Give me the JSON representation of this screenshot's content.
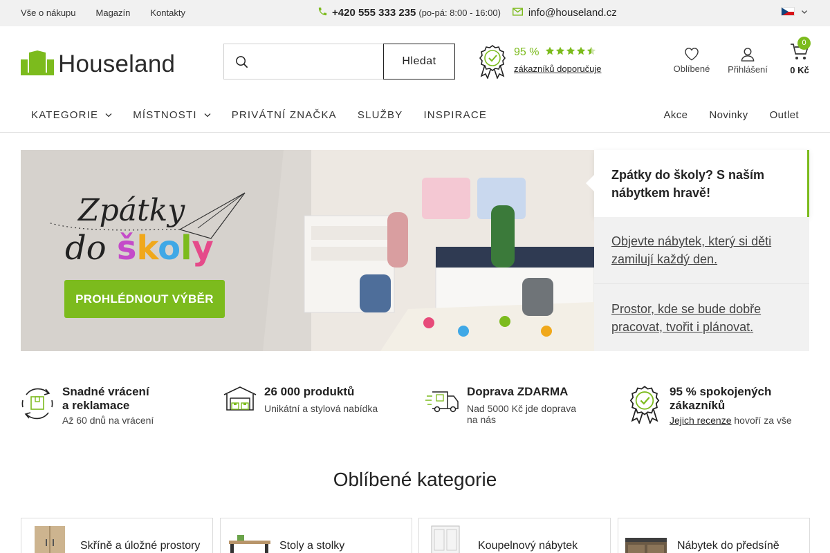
{
  "topbar": {
    "links": [
      "Vše o nákupu",
      "Magazín",
      "Kontakty"
    ],
    "phone": "+420 555 333 235",
    "hours": "(po-pá: 8:00 - 16:00)",
    "email": "info@houseland.cz",
    "language_icon": "czech-flag-icon"
  },
  "header": {
    "logo_text": "Houseland",
    "search_placeholder": "",
    "search_button": "Hledat",
    "rating_percent": "95 %",
    "rating_stars": 4.5,
    "rating_link": "zákazníků doporučuje",
    "favorites_label": "Oblíbené",
    "login_label": "Přihlášení",
    "cart_count": "0",
    "cart_total": "0 Kč"
  },
  "nav": {
    "main": [
      {
        "label": "KATEGORIE",
        "has_dropdown": true
      },
      {
        "label": "MÍSTNOSTI",
        "has_dropdown": true
      },
      {
        "label": "PRIVÁTNÍ ZNAČKA",
        "has_dropdown": false
      },
      {
        "label": "SLUŽBY",
        "has_dropdown": false
      },
      {
        "label": "INSPIRACE",
        "has_dropdown": false
      }
    ],
    "side": [
      "Akce",
      "Novinky",
      "Outlet"
    ]
  },
  "hero": {
    "headline_line1": "Zpátky",
    "headline_do": "do",
    "headline_skoly": [
      "š",
      "k",
      "o",
      "l",
      "y"
    ],
    "skoly_colors": [
      "#c44bc9",
      "#f0a81b",
      "#3fa8e6",
      "#7cbb1d",
      "#e54b8a"
    ],
    "cta": "PROHLÉDNOUT VÝBĚR",
    "slides": [
      "Zpátky do školy? S naším nábytkem hravě!",
      "Objevte nábytek, který si děti zamilují každý den.",
      "Prostor, kde se bude dobře pracovat, tvořit i plánovat."
    ]
  },
  "benefits": [
    {
      "title_line1": "Snadné vrácení",
      "title_line2": "a reklamace",
      "desc": "Až 60 dnů na vrácení",
      "icon": "return-box-icon"
    },
    {
      "title_line1": "26 000 produktů",
      "title_line2": "",
      "desc": "Unikátní a stylová nabídka",
      "icon": "warehouse-icon"
    },
    {
      "title_line1": "Doprava ZDARMA",
      "title_line2": "",
      "desc": "Nad 5000 Kč jde doprava na nás",
      "icon": "delivery-truck-icon"
    },
    {
      "title_line1": "95 % spokojených",
      "title_line2": "zákazníků",
      "desc_link": "Jejich recenze",
      "desc_rest": " hovoří za vše",
      "icon": "award-badge-icon"
    }
  ],
  "categories": {
    "title": "Oblíbené kategorie",
    "items": [
      {
        "label": "Skříně a úložné prostory",
        "icon": "wardrobe-icon"
      },
      {
        "label": "Stoly a stolky",
        "icon": "table-icon"
      },
      {
        "label": "Koupelnový nábytek",
        "icon": "bathroom-cabinet-icon"
      },
      {
        "label": "Nábytek do předsíně",
        "icon": "hallway-furniture-icon"
      }
    ]
  },
  "colors": {
    "brand_green": "#7cbb1d",
    "topbar_bg": "#f1f1f1",
    "slide_bg": "#f1f1f1"
  }
}
